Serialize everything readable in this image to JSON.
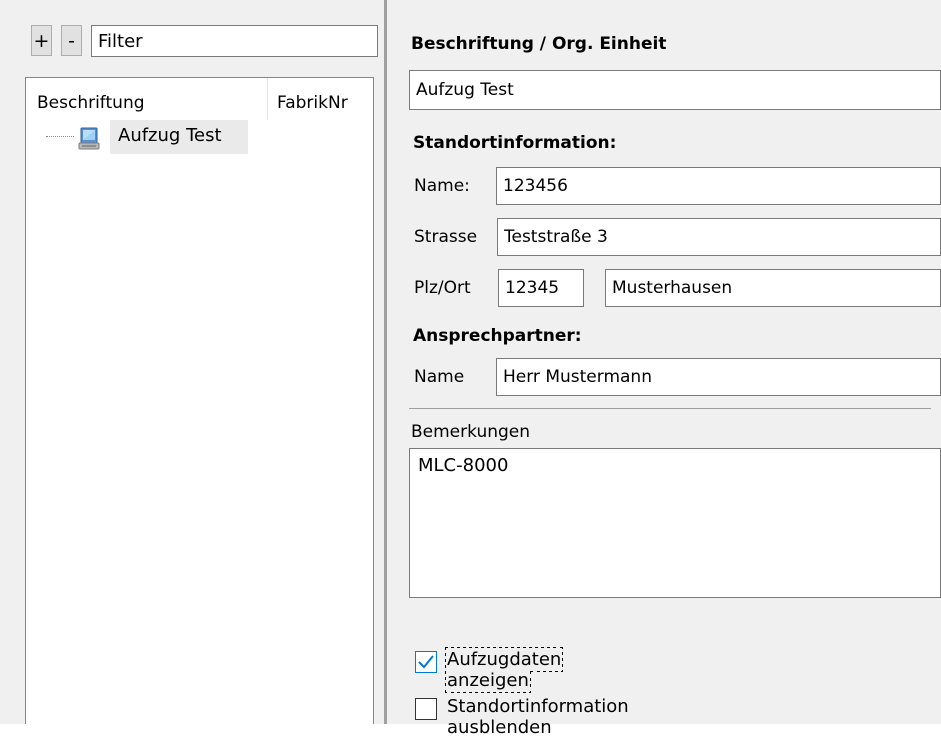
{
  "left": {
    "plus_label": "+",
    "minus_label": "-",
    "filter_value": "Filter",
    "columns": [
      "Beschriftung",
      "FabrikNr"
    ],
    "tree_items": [
      {
        "label": "Aufzug Test",
        "icon": "computer-icon"
      }
    ]
  },
  "right": {
    "org_unit_heading": "Beschriftung / Org. Einheit",
    "org_unit_value": "Aufzug Test",
    "location_heading": "Standortinformation:",
    "name_label": "Name:",
    "name_value": "123456",
    "strasse_label": "Strasse",
    "strasse_value": "Teststraße 3",
    "plzort_label": "Plz/Ort",
    "plz_value": "12345",
    "ort_value": "Musterhausen",
    "contact_heading": "Ansprechpartner:",
    "contact_label": "Name",
    "contact_value": "Herr Mustermann",
    "notes_label": "Bemerkungen",
    "notes_value": "MLC-8000",
    "checkboxes": [
      {
        "label": "Aufzugdaten anzeigen",
        "checked": true
      },
      {
        "label": "Standortinformation ausblenden",
        "checked": false
      }
    ]
  },
  "colors": {
    "accent": "#0078d7",
    "panel_bg": "#f0f0f0",
    "selection_bg": "#eaeaea"
  }
}
